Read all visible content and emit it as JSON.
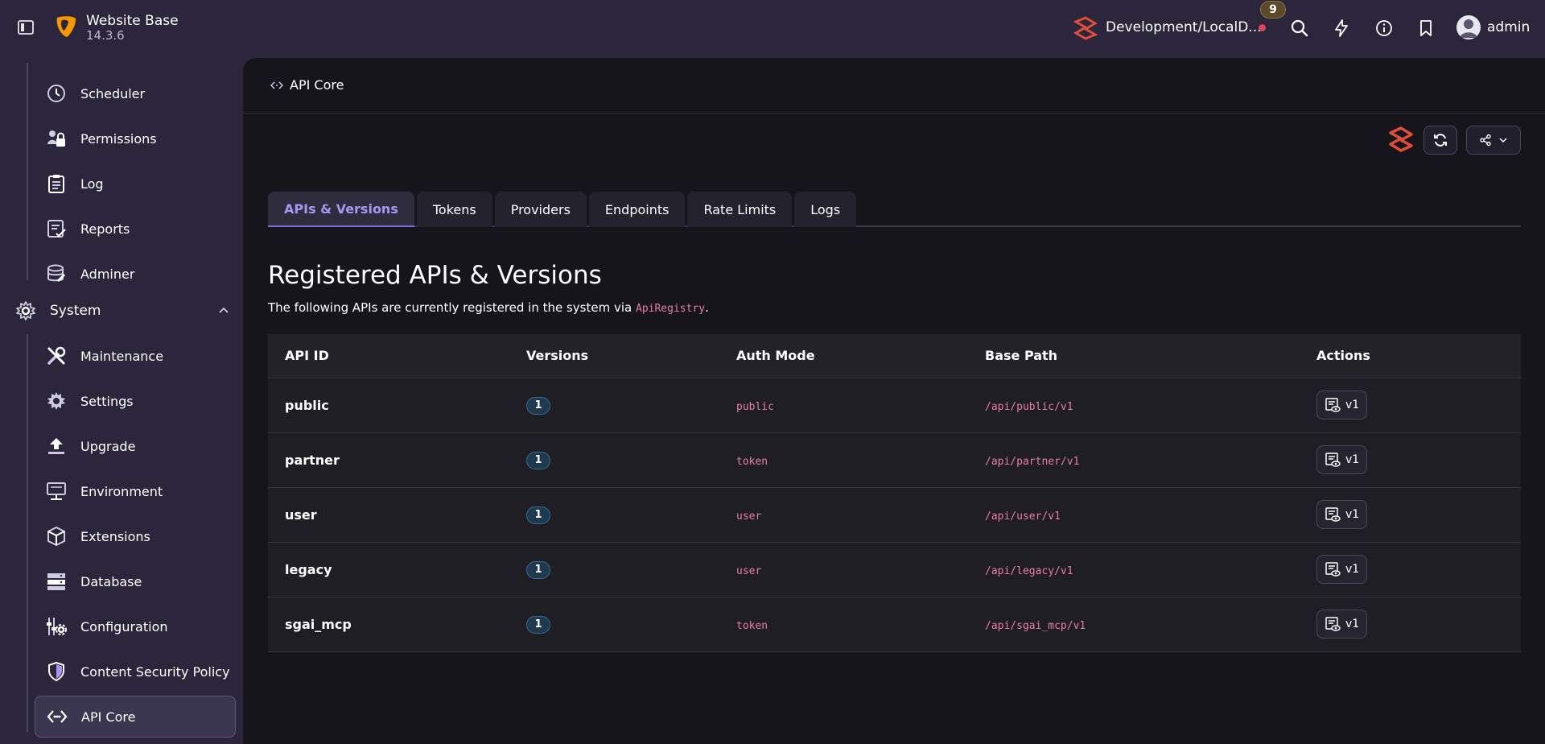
{
  "topbar": {
    "site_name": "Website Base",
    "site_version": "14.3.6",
    "environment": "Development/LocalD...",
    "notification_count": "9",
    "user": "admin"
  },
  "sidebar": {
    "items_top": [
      {
        "label": "Scheduler",
        "icon": "clock-icon"
      },
      {
        "label": "Permissions",
        "icon": "lock-icon"
      },
      {
        "label": "Log",
        "icon": "log-icon"
      },
      {
        "label": "Reports",
        "icon": "report-icon"
      },
      {
        "label": "Adminer",
        "icon": "database-icon"
      }
    ],
    "group": {
      "label": "System",
      "icon": "gear-icon"
    },
    "items_system": [
      {
        "label": "Maintenance",
        "icon": "tools-icon"
      },
      {
        "label": "Settings",
        "icon": "gear-icon"
      },
      {
        "label": "Upgrade",
        "icon": "upload-icon"
      },
      {
        "label": "Environment",
        "icon": "monitor-icon"
      },
      {
        "label": "Extensions",
        "icon": "cube-icon"
      },
      {
        "label": "Database",
        "icon": "server-icon"
      },
      {
        "label": "Configuration",
        "icon": "sliders-icon"
      },
      {
        "label": "Content Security Policy",
        "icon": "shield-icon"
      },
      {
        "label": "API Core",
        "icon": "code-icon",
        "active": true
      }
    ]
  },
  "main": {
    "breadcrumb": "API Core",
    "tabs": [
      {
        "label": "APIs & Versions",
        "active": true
      },
      {
        "label": "Tokens"
      },
      {
        "label": "Providers"
      },
      {
        "label": "Endpoints"
      },
      {
        "label": "Rate Limits"
      },
      {
        "label": "Logs"
      }
    ],
    "title": "Registered APIs & Versions",
    "description_prefix": "The following APIs are currently registered in the system via ",
    "description_code": "ApiRegistry",
    "description_suffix": ".",
    "table": {
      "headers": [
        "API ID",
        "Versions",
        "Auth Mode",
        "Base Path",
        "Actions"
      ],
      "rows": [
        {
          "id": "public",
          "versions": "1",
          "auth": "public",
          "path": "/api/public/v1",
          "action": "v1"
        },
        {
          "id": "partner",
          "versions": "1",
          "auth": "token",
          "path": "/api/partner/v1",
          "action": "v1"
        },
        {
          "id": "user",
          "versions": "1",
          "auth": "user",
          "path": "/api/user/v1",
          "action": "v1"
        },
        {
          "id": "legacy",
          "versions": "1",
          "auth": "user",
          "path": "/api/legacy/v1",
          "action": "v1"
        },
        {
          "id": "sgai_mcp",
          "versions": "1",
          "auth": "token",
          "path": "/api/sgai_mcp/v1",
          "action": "v1"
        }
      ]
    }
  },
  "colors": {
    "accent": "#7f6ad9",
    "code": "#e77fa4",
    "brand": "#f49700"
  }
}
